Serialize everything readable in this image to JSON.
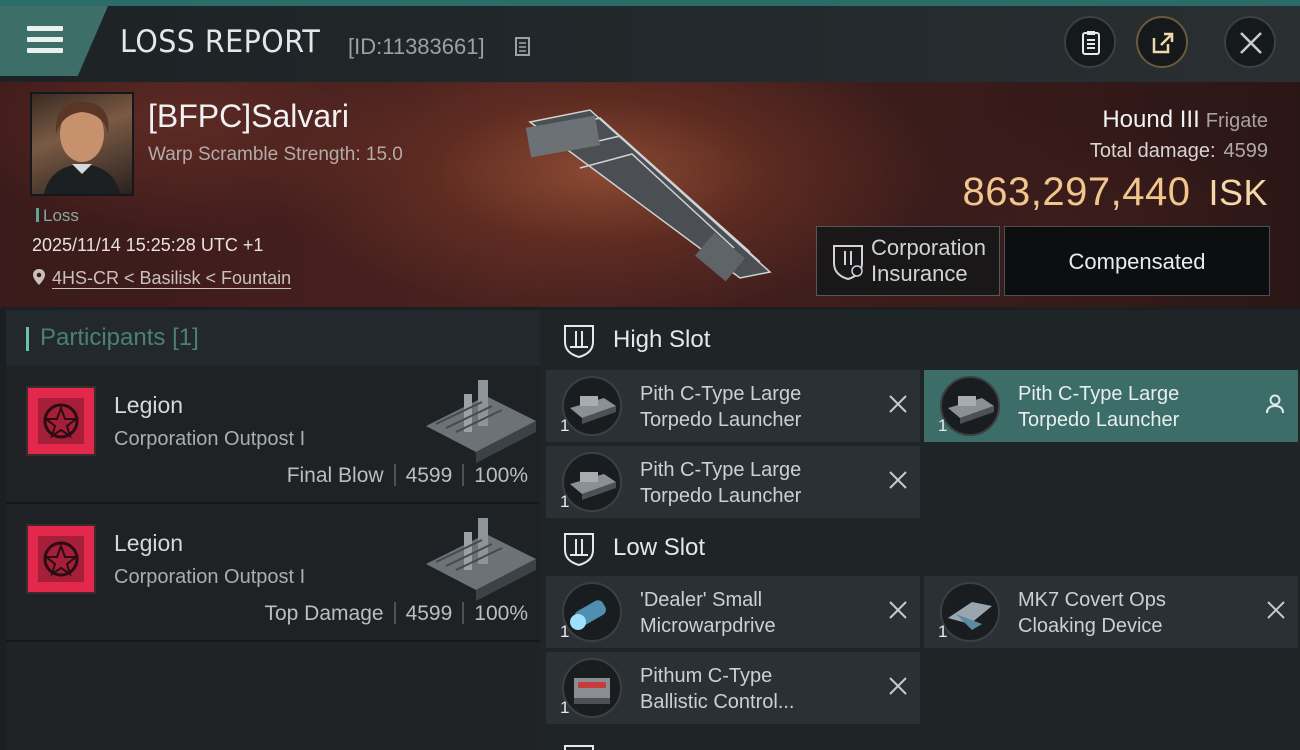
{
  "header": {
    "title": "LOSS REPORT",
    "report_id": "[ID:11383661]"
  },
  "victim": {
    "pilot": "[BFPC]Salvari",
    "warp_scramble": "Warp Scramble Strength: 15.0",
    "status": "Loss",
    "timestamp": "2025/11/14 15:25:28 UTC +1",
    "location": "4HS-CR < Basilisk < Fountain",
    "ship_name": "Hound III",
    "ship_class": "Frigate",
    "total_damage_label": "Total damage:",
    "total_damage": "4599",
    "isk_value": "863,297,440",
    "isk_currency": "ISK",
    "insurance_line1": "Corporation",
    "insurance_line2": "Insurance",
    "compensation": "Compensated"
  },
  "participants": {
    "label": "Participants",
    "count": "[1]",
    "rows": [
      {
        "name": "Legion",
        "ship": "Corporation Outpost I",
        "role": "Final Blow",
        "damage": "4599",
        "percent": "100%"
      },
      {
        "name": "Legion",
        "ship": "Corporation Outpost I",
        "role": "Top Damage",
        "damage": "4599",
        "percent": "100%"
      }
    ]
  },
  "fitting": {
    "high_slot_label": "High Slot",
    "low_slot_label": "Low Slot",
    "high_slot": [
      {
        "qty": "1",
        "line1": "Pith C-Type Large",
        "line2": "Torpedo Launcher"
      },
      {
        "qty": "1",
        "line1": "Pith C-Type Large",
        "line2": "Torpedo Launcher"
      },
      {
        "qty": "1",
        "line1": "Pith C-Type Large",
        "line2": "Torpedo Launcher"
      }
    ],
    "low_slot": [
      {
        "qty": "1",
        "line1": "'Dealer' Small",
        "line2": "Microwarpdrive"
      },
      {
        "qty": "1",
        "line1": "MK7 Covert Ops",
        "line2": "Cloaking Device"
      },
      {
        "qty": "1",
        "line1": "Pithum C-Type",
        "line2": "Ballistic Control..."
      }
    ]
  },
  "colors": {
    "accent_teal": "#3d6d69",
    "isk_gold": "#f1c58c",
    "corp_red": "#e3294b"
  },
  "icons": [
    "menu-icon",
    "copy-icon",
    "clipboard-icon",
    "share-icon",
    "close-icon",
    "location-pin-icon",
    "insurance-shield-icon",
    "slot-shield-icon",
    "remove-x-icon",
    "person-icon"
  ]
}
